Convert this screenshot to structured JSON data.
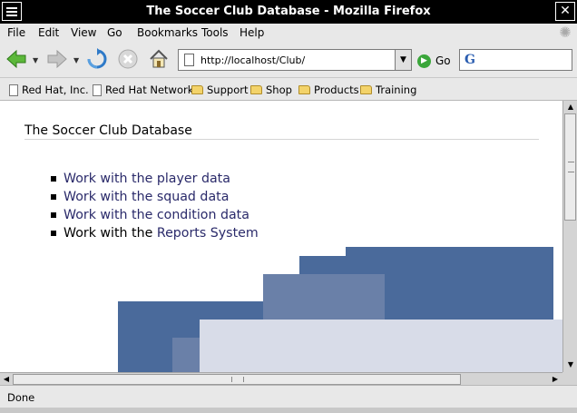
{
  "window": {
    "title": "The Soccer Club Database - Mozilla Firefox"
  },
  "menu": [
    "File",
    "Edit",
    "View",
    "Go",
    "Bookmarks",
    "Tools",
    "Help"
  ],
  "navbar": {
    "url": "http://localhost/Club/",
    "go_label": "Go",
    "search_engine_icon": "G"
  },
  "bookmarks": [
    {
      "label": "Red Hat, Inc.",
      "icon": "page-icon"
    },
    {
      "label": "Red Hat Network",
      "icon": "page-icon"
    },
    {
      "label": "Support",
      "icon": "folder-icon"
    },
    {
      "label": "Shop",
      "icon": "folder-icon"
    },
    {
      "label": "Products",
      "icon": "folder-icon"
    },
    {
      "label": "Training",
      "icon": "folder-icon"
    }
  ],
  "page": {
    "heading": "The Soccer Club Database",
    "links": [
      {
        "prefix": "",
        "link_text": "Work with the player data"
      },
      {
        "prefix": "",
        "link_text": "Work with the squad data"
      },
      {
        "prefix": "",
        "link_text": "Work with the condition data"
      },
      {
        "prefix": "Work with the ",
        "link_text": "Reports System"
      }
    ]
  },
  "status": {
    "text": "Done"
  },
  "colors": {
    "link": "#2a2a6a",
    "block_dark": "#4a6a9b",
    "block_mid": "#6a80a8",
    "block_light": "#d8dce8"
  }
}
